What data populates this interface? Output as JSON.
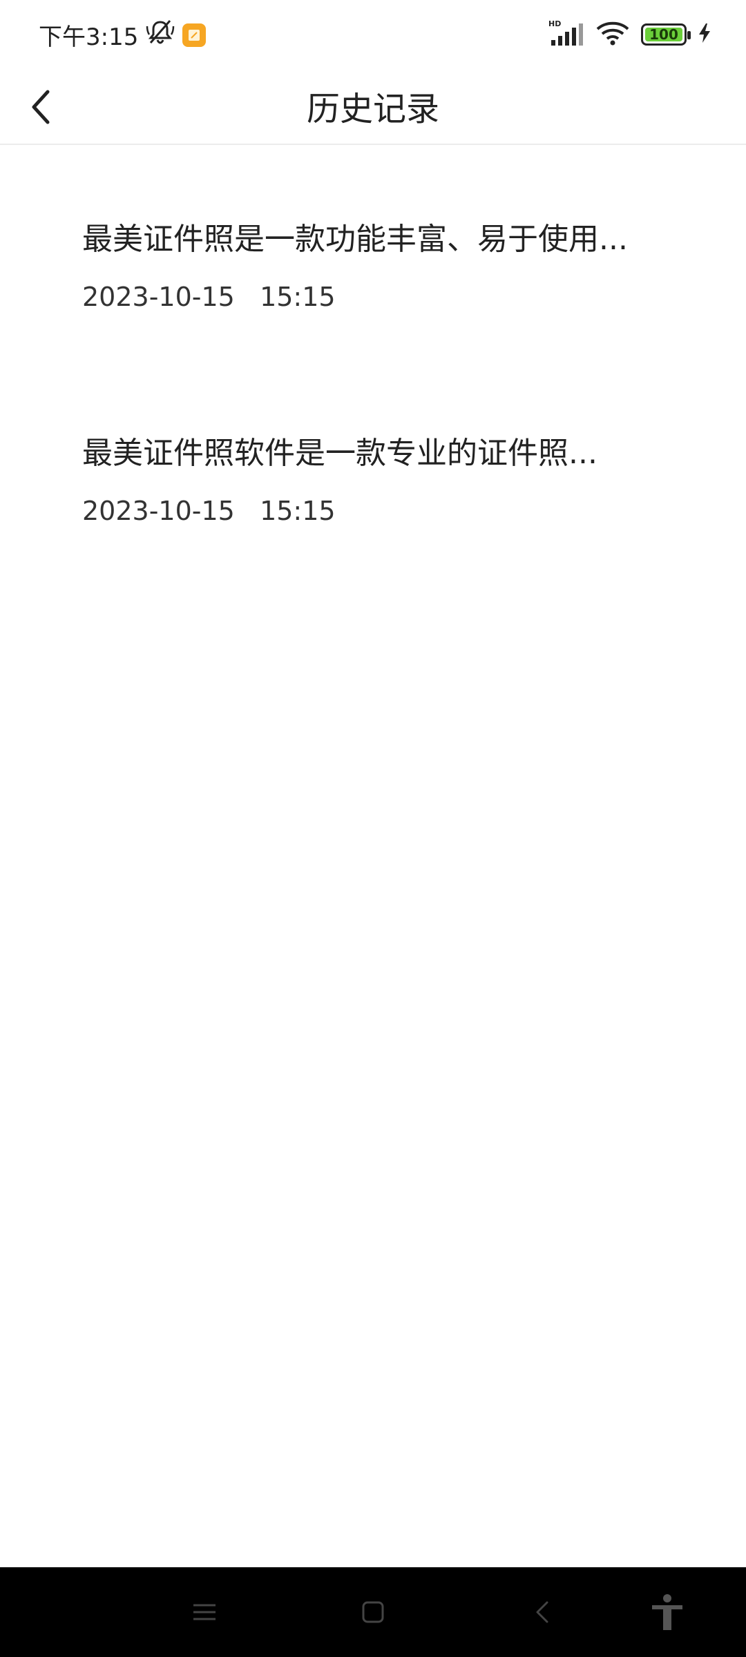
{
  "status_bar": {
    "time": "下午3:15",
    "network": "HD",
    "battery": "100",
    "battery_level_percent": 100,
    "icons": [
      "mute-icon",
      "app-notification-icon",
      "signal-icon",
      "wifi-icon",
      "battery-icon",
      "charging-icon"
    ]
  },
  "header": {
    "title": "历史记录",
    "back_icon": "chevron-left-icon"
  },
  "history": {
    "items": [
      {
        "title": "最美证件照是一款功能丰富、易于使用...",
        "time": "2023-10-15   15:15"
      },
      {
        "title": "最美证件照软件是一款专业的证件照...",
        "time": "2023-10-15   15:15"
      }
    ]
  },
  "nav_bar": {
    "icons": [
      "menu-icon",
      "home-icon",
      "back-icon",
      "accessibility-icon"
    ]
  },
  "colors": {
    "background": "#ffffff",
    "text": "#222222",
    "divider": "#ececec",
    "nav_bar": "#000000",
    "battery_fill": "#6bcf3a",
    "app_notification": "#f6a623"
  }
}
